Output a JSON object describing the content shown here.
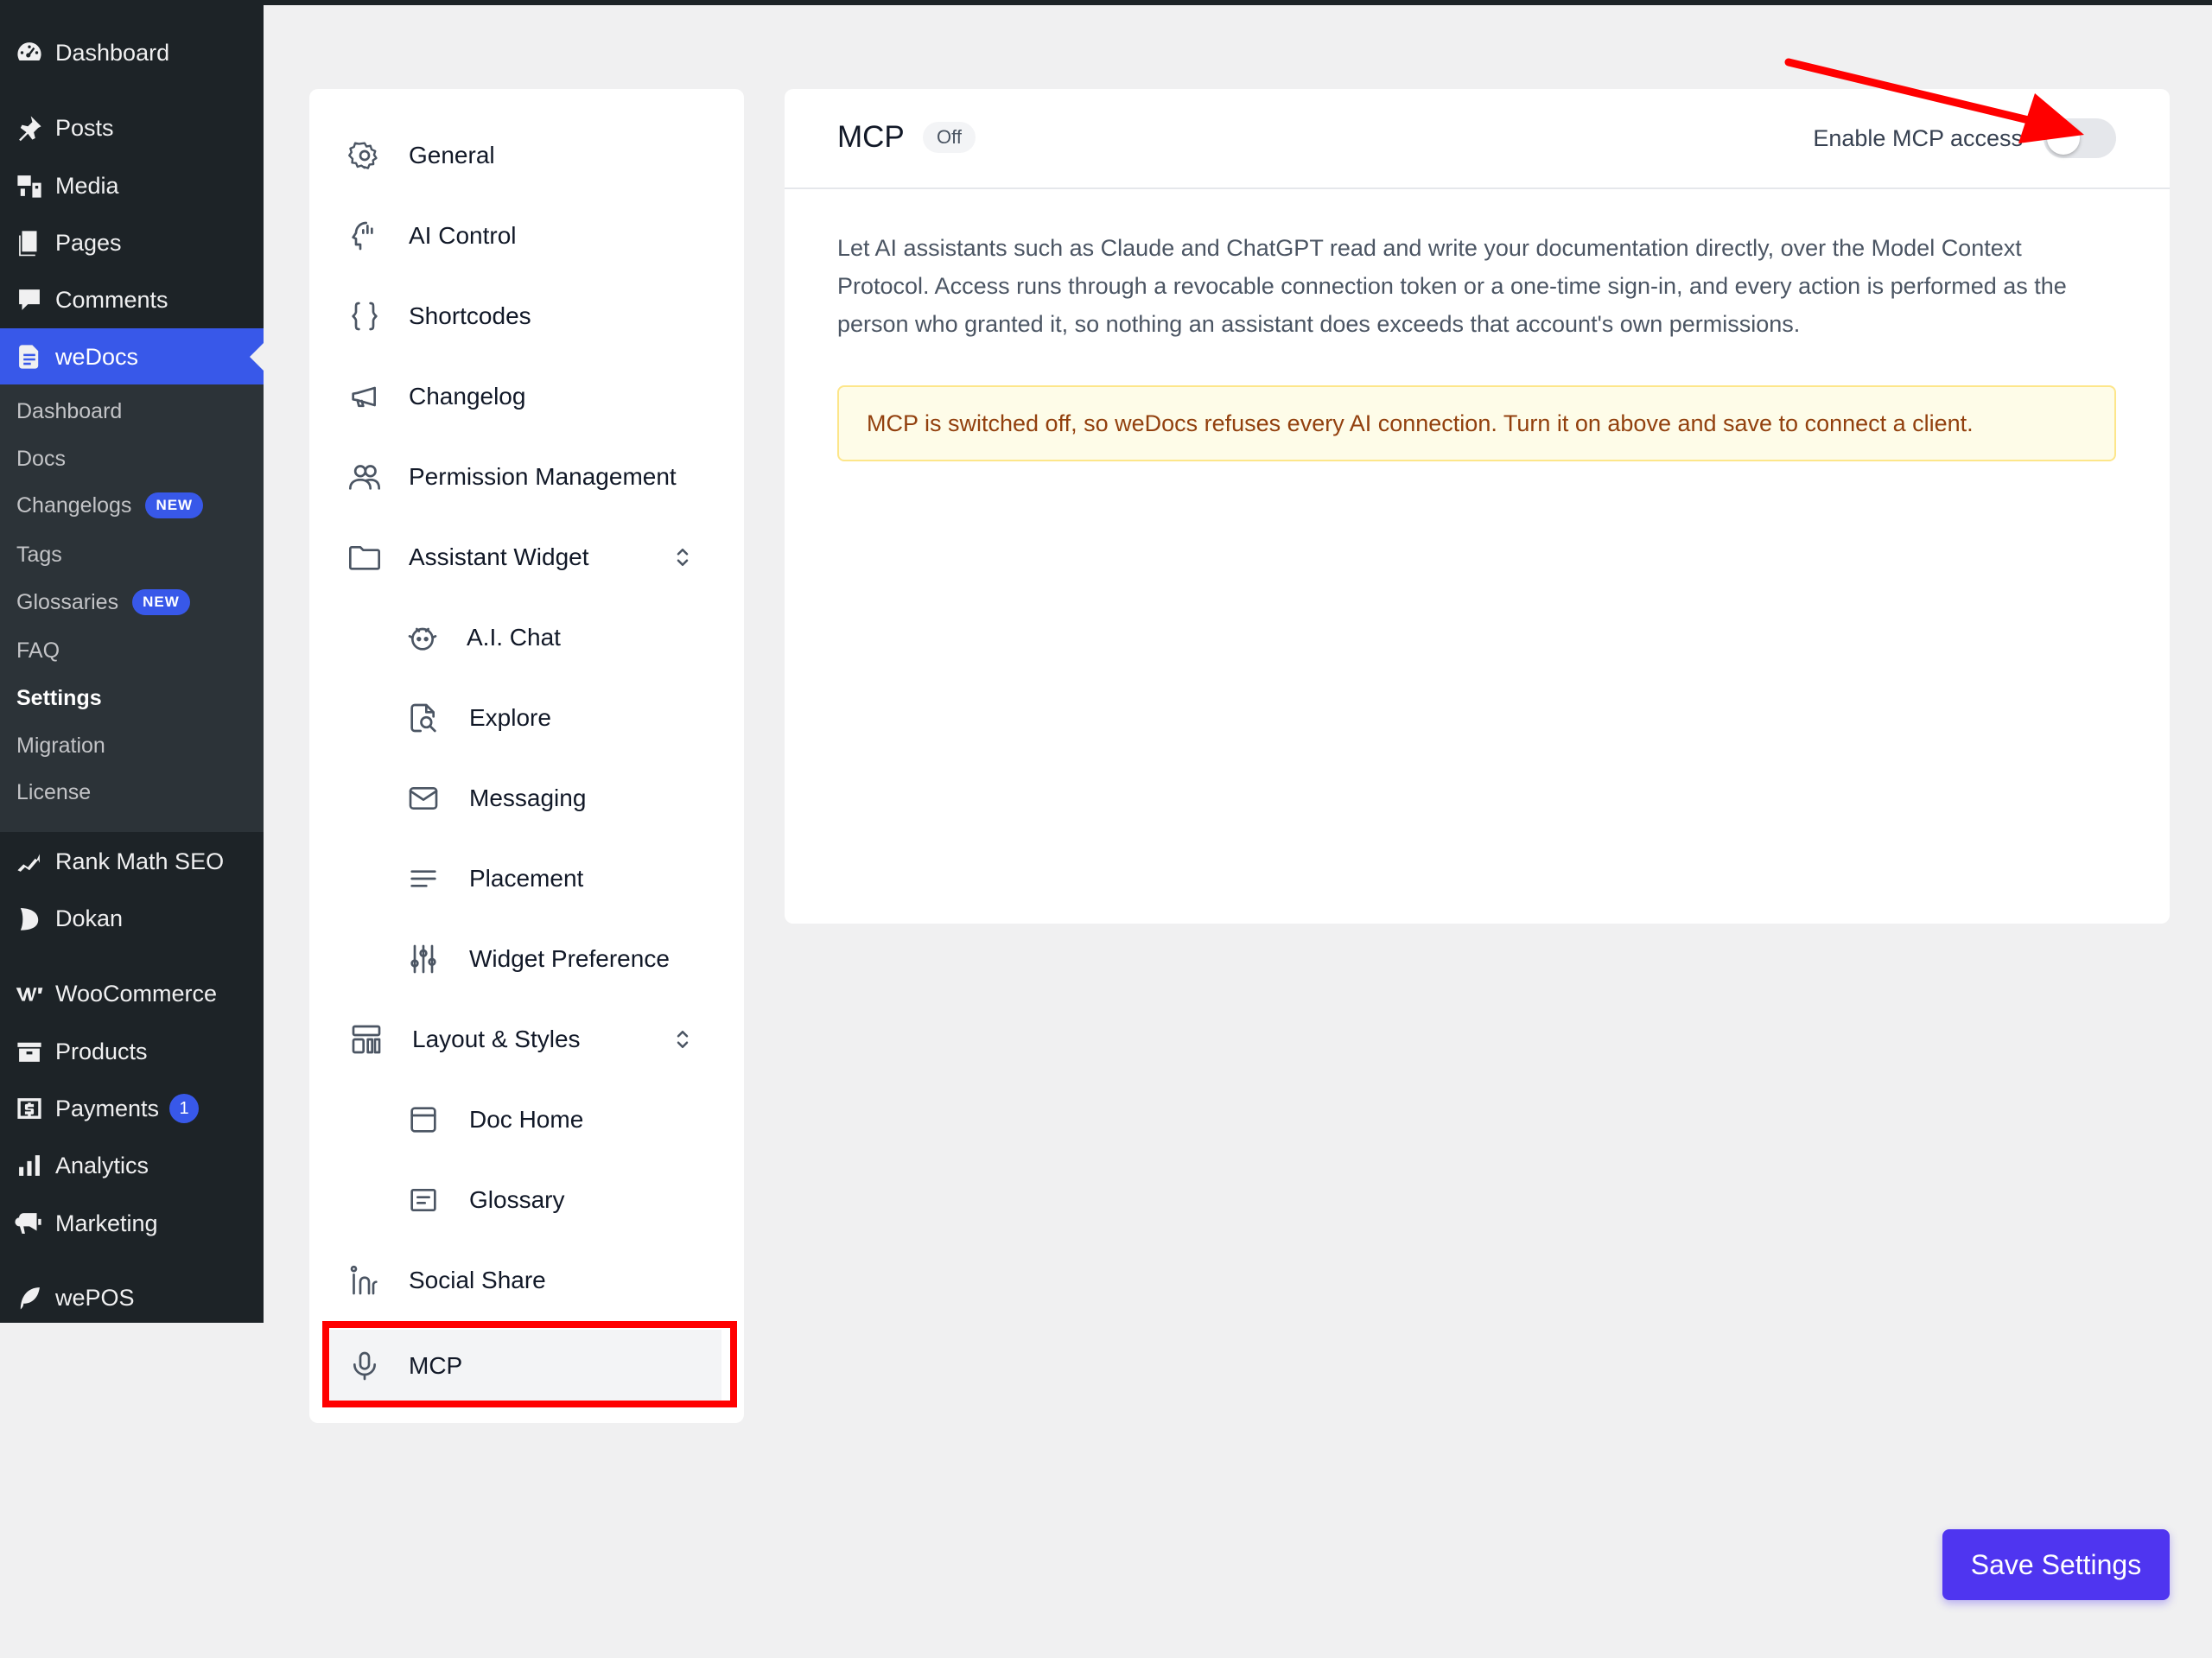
{
  "wp_menu": {
    "items": [
      {
        "label": "Dashboard",
        "icon": "dashboard-icon"
      },
      {
        "label": "Posts",
        "icon": "pin-icon"
      },
      {
        "label": "Media",
        "icon": "media-icon"
      },
      {
        "label": "Pages",
        "icon": "pages-icon"
      },
      {
        "label": "Comments",
        "icon": "comments-icon"
      },
      {
        "label": "weDocs",
        "icon": "wedocs-icon"
      },
      {
        "label": "Rank Math SEO",
        "icon": "rankmath-icon"
      },
      {
        "label": "Dokan",
        "icon": "dokan-icon"
      },
      {
        "label": "WooCommerce",
        "icon": "woocommerce-icon"
      },
      {
        "label": "Products",
        "icon": "products-icon"
      },
      {
        "label": "Payments",
        "icon": "payments-icon",
        "badge": "1"
      },
      {
        "label": "Analytics",
        "icon": "analytics-icon"
      },
      {
        "label": "Marketing",
        "icon": "marketing-icon"
      },
      {
        "label": "wePOS",
        "icon": "wepos-icon"
      }
    ],
    "submenu": [
      {
        "label": "Dashboard"
      },
      {
        "label": "Docs"
      },
      {
        "label": "Changelogs",
        "badge": "NEW"
      },
      {
        "label": "Tags"
      },
      {
        "label": "Glossaries",
        "badge": "NEW"
      },
      {
        "label": "FAQ"
      },
      {
        "label": "Settings"
      },
      {
        "label": "Migration"
      },
      {
        "label": "License"
      }
    ]
  },
  "settings_nav": {
    "items": [
      {
        "label": "General",
        "icon": "gear-icon"
      },
      {
        "label": "AI Control",
        "icon": "ai-head-icon"
      },
      {
        "label": "Shortcodes",
        "icon": "braces-icon"
      },
      {
        "label": "Changelog",
        "icon": "megaphone-icon"
      },
      {
        "label": "Permission Management",
        "icon": "users-icon"
      },
      {
        "label": "Assistant Widget",
        "icon": "folder-icon"
      },
      {
        "label": "A.I. Chat",
        "icon": "bot-icon"
      },
      {
        "label": "Explore",
        "icon": "search-doc-icon"
      },
      {
        "label": "Messaging",
        "icon": "mail-icon"
      },
      {
        "label": "Placement",
        "icon": "lines-icon"
      },
      {
        "label": "Widget Preference",
        "icon": "sliders-icon"
      },
      {
        "label": "Layout & Styles",
        "icon": "layout-icon"
      },
      {
        "label": "Doc Home",
        "icon": "window-icon"
      },
      {
        "label": "Glossary",
        "icon": "glossary-icon"
      },
      {
        "label": "Social Share",
        "icon": "social-icon"
      },
      {
        "label": "MCP",
        "icon": "microphone-icon"
      }
    ]
  },
  "main": {
    "title": "MCP",
    "status_badge": "Off",
    "enable_label": "Enable MCP access",
    "toggle_on": false,
    "description": "Let AI assistants such as Claude and ChatGPT read and write your documentation directly, over the Model Context Protocol. Access runs through a revocable connection token or a one-time sign-in, and every action is performed as the person who granted it, so nothing an assistant does exceeds that account's own permissions.",
    "notice": "MCP is switched off, so weDocs refuses every AI connection. Turn it on above and save to connect a client."
  },
  "save_button": "Save Settings",
  "colors": {
    "accent": "#3858e9",
    "save_button": "#4f35f0",
    "highlight": "#ff0000",
    "notice_bg": "#fefce8",
    "notice_text": "#92400e"
  }
}
